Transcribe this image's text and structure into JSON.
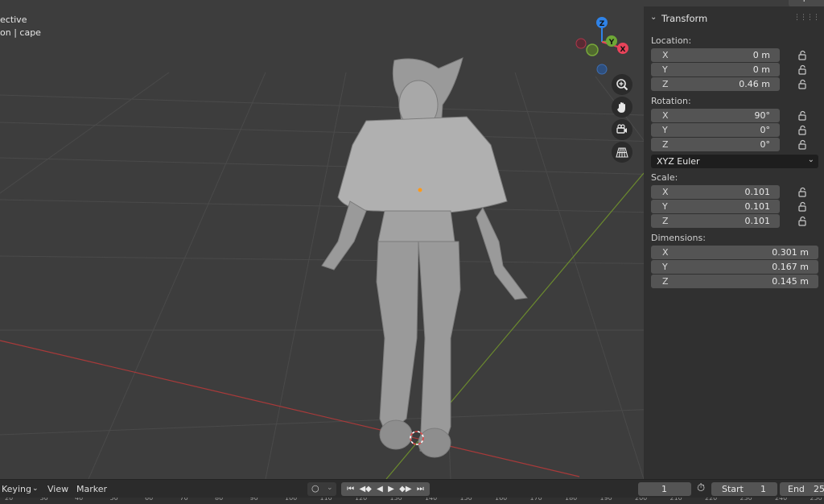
{
  "viewport": {
    "overlay_line1": "ective",
    "overlay_line2": "on | cape"
  },
  "gizmo": {
    "z_label": "Z",
    "y_label": "Y",
    "x_label": "X"
  },
  "nav_icons": [
    "zoom-icon",
    "hand-pan-icon",
    "camera-icon",
    "grid-perspective-icon"
  ],
  "options_tab": "Option",
  "panel": {
    "title": "Transform",
    "location_label": "Location:",
    "location": [
      {
        "axis": "X",
        "value": "0 m"
      },
      {
        "axis": "Y",
        "value": "0 m"
      },
      {
        "axis": "Z",
        "value": "0.46 m"
      }
    ],
    "rotation_label": "Rotation:",
    "rotation": [
      {
        "axis": "X",
        "value": "90°"
      },
      {
        "axis": "Y",
        "value": "0°"
      },
      {
        "axis": "Z",
        "value": "0°"
      }
    ],
    "rotation_mode": "XYZ Euler",
    "scale_label": "Scale:",
    "scale": [
      {
        "axis": "X",
        "value": "0.101"
      },
      {
        "axis": "Y",
        "value": "0.101"
      },
      {
        "axis": "Z",
        "value": "0.101"
      }
    ],
    "dimensions_label": "Dimensions:",
    "dimensions": [
      {
        "axis": "X",
        "value": "0.301 m"
      },
      {
        "axis": "Y",
        "value": "0.167 m"
      },
      {
        "axis": "Z",
        "value": "0.145 m"
      }
    ]
  },
  "timeline": {
    "keying": "Keying",
    "view": "View",
    "marker": "Marker",
    "current_frame": "1",
    "start_label": "Start",
    "start_value": "1",
    "end_label": "End",
    "end_value": "25",
    "ruler_ticks": [
      "20",
      "30",
      "40",
      "50",
      "60",
      "70",
      "80",
      "90",
      "100",
      "110",
      "120",
      "130",
      "140",
      "150",
      "160",
      "170",
      "180",
      "190",
      "200",
      "210",
      "220",
      "230",
      "240",
      "250"
    ]
  },
  "colors": {
    "x_axis": "#e8435a",
    "y_axis": "#6ea836",
    "z_axis": "#2f83e8",
    "viewport_bg": "#3d3d3d",
    "panel_bg": "#303030",
    "field_bg": "#545454"
  }
}
